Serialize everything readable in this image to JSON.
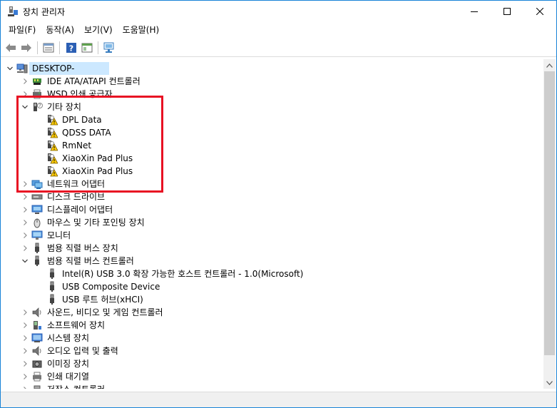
{
  "window": {
    "title": "장치 관리자"
  },
  "menu": [
    "파일(F)",
    "동작(A)",
    "보기(V)",
    "도움말(H)"
  ],
  "toolbar_icons": [
    "back-icon",
    "forward-icon",
    "properties-icon",
    "help-icon",
    "console-icon",
    "scan-hardware-icon"
  ],
  "tree": {
    "root": "DESKTOP-",
    "items": [
      {
        "label": "IDE ATA/ATAPI 컨트롤러",
        "expanded": false,
        "icon": "ide-controller-icon"
      },
      {
        "label": "WSD 인쇄 공급자",
        "expanded": false,
        "icon": "printer-provider-icon"
      },
      {
        "label": "기타 장치",
        "expanded": true,
        "icon": "unknown-device-icon",
        "children": [
          "DPL Data",
          "QDSS DATA",
          "RmNet",
          "XiaoXin Pad Plus",
          "XiaoXin Pad Plus"
        ]
      },
      {
        "label": "네트워크 어댑터",
        "expanded": false,
        "icon": "network-adapter-icon"
      },
      {
        "label": "디스크 드라이브",
        "expanded": false,
        "icon": "disk-drive-icon"
      },
      {
        "label": "디스플레이 어댑터",
        "expanded": false,
        "icon": "display-adapter-icon"
      },
      {
        "label": "마우스 및 기타 포인팅 장치",
        "expanded": false,
        "icon": "mouse-icon"
      },
      {
        "label": "모니터",
        "expanded": false,
        "icon": "monitor-icon"
      },
      {
        "label": "범용 직렬 버스 장치",
        "expanded": false,
        "icon": "usb-icon"
      },
      {
        "label": "범용 직렬 버스 컨트롤러",
        "expanded": true,
        "icon": "usb-icon",
        "children": [
          "Intel(R) USB 3.0 확장 가능한 호스트 컨트롤러 - 1.0(Microsoft)",
          "USB Composite Device",
          "USB 루트 허브(xHCI)"
        ]
      },
      {
        "label": "사운드, 비디오 및 게임 컨트롤러",
        "expanded": false,
        "icon": "speaker-icon"
      },
      {
        "label": "소프트웨어 장치",
        "expanded": false,
        "icon": "software-device-icon"
      },
      {
        "label": "시스템 장치",
        "expanded": false,
        "icon": "system-device-icon"
      },
      {
        "label": "오디오 입력 및 출력",
        "expanded": false,
        "icon": "speaker-icon"
      },
      {
        "label": "이미징 장치",
        "expanded": false,
        "icon": "camera-icon"
      },
      {
        "label": "인쇄 대기열",
        "expanded": false,
        "icon": "printer-icon"
      },
      {
        "label": "저장소 컨트롤러",
        "expanded": false,
        "icon": "storage-controller-icon"
      }
    ]
  },
  "colors": {
    "selection": "#cce8ff",
    "highlight_box": "#e81123",
    "warning": "#ffcc00"
  }
}
